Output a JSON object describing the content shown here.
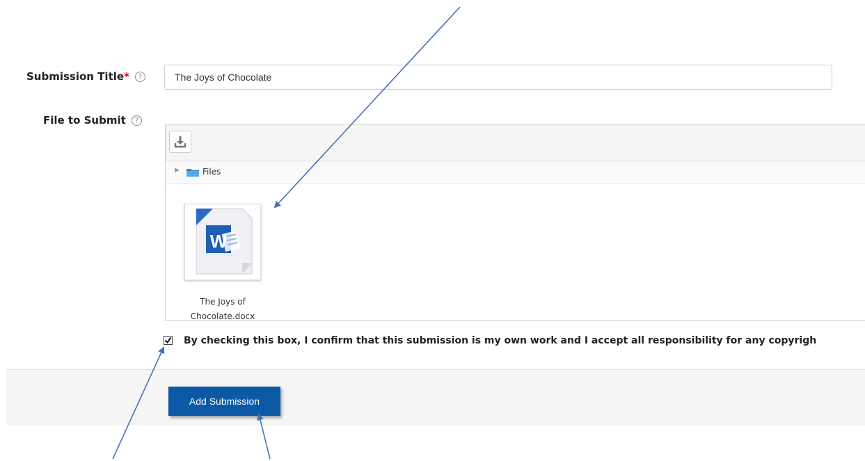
{
  "form": {
    "title_label": "Submission Title",
    "required_mark": "*",
    "help_glyph": "?",
    "title_value": "The Joys of Chocolate",
    "file_label": "File to Submit"
  },
  "file_manager": {
    "download_icon": "download-icon",
    "path_folder": "Files",
    "files": [
      {
        "name_line1": "The Joys of",
        "name_line2": "Chocolate.docx",
        "icon": "word-document-icon"
      }
    ]
  },
  "confirm": {
    "checked": true,
    "text": "By checking this box, I confirm that this submission is my own work and I accept all responsibility for any copyrigh"
  },
  "actions": {
    "submit_label": "Add Submission"
  },
  "colors": {
    "button": "#0c5aa6",
    "required": "#d0021b",
    "arrow": "#4a72b0"
  }
}
